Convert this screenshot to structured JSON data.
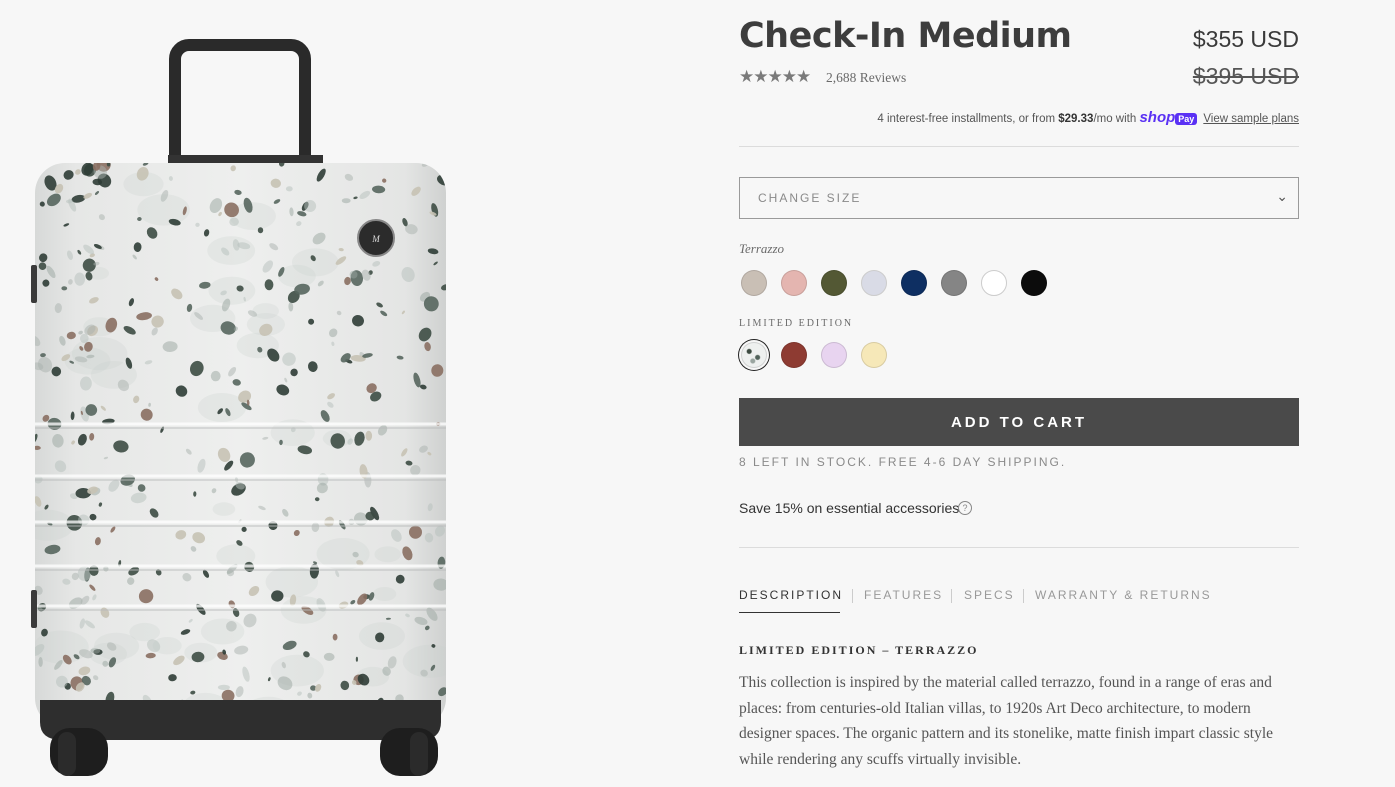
{
  "product": {
    "title": "Check-In Medium",
    "price": "$355 USD",
    "original_price": "$395 USD",
    "rating": 5,
    "stars": "★★★★★",
    "reviews": "2,688 Reviews"
  },
  "installments": {
    "prefix": "4 interest-free installments, or from ",
    "amount": "$29.33",
    "suffix": "/mo with ",
    "brand": "shop",
    "badge": "Pay",
    "link": "View sample plans"
  },
  "size_select": {
    "label": "CHANGE SIZE",
    "chevron": "⌄"
  },
  "colors": {
    "label": "Terrazzo",
    "standard": [
      "#c9bfb5",
      "#e4b5b0",
      "#535834",
      "#d9dbe6",
      "#0e2f62",
      "#858585",
      "#ffffff",
      "#0c0c0c"
    ],
    "limited_label": "LIMITED EDITION",
    "limited": [
      "terrazzo-pattern",
      "#8e3b32",
      "#e8d4f0",
      "#f6e8b8"
    ],
    "selected": "terrazzo-pattern"
  },
  "cart": {
    "button": "ADD TO CART",
    "stock": "8 LEFT IN STOCK. FREE 4-6 DAY SHIPPING."
  },
  "promo": {
    "text": "Save 15% on essential accessories",
    "help_icon": "?"
  },
  "tabs": [
    "DESCRIPTION",
    "FEATURES",
    "SPECS",
    "WARRANTY & RETURNS"
  ],
  "description": {
    "title": "LIMITED EDITION – TERRAZZO",
    "body": "This collection is inspired by the material called terrazzo, found in a range of eras and places: from centuries-old Italian villas, to 1920s Art Deco architecture, to modern designer spaces. The organic pattern and its stonelike, matte finish impart classic style while rendering any scuffs virtually invisible."
  },
  "image": {
    "logo_text": "M"
  }
}
